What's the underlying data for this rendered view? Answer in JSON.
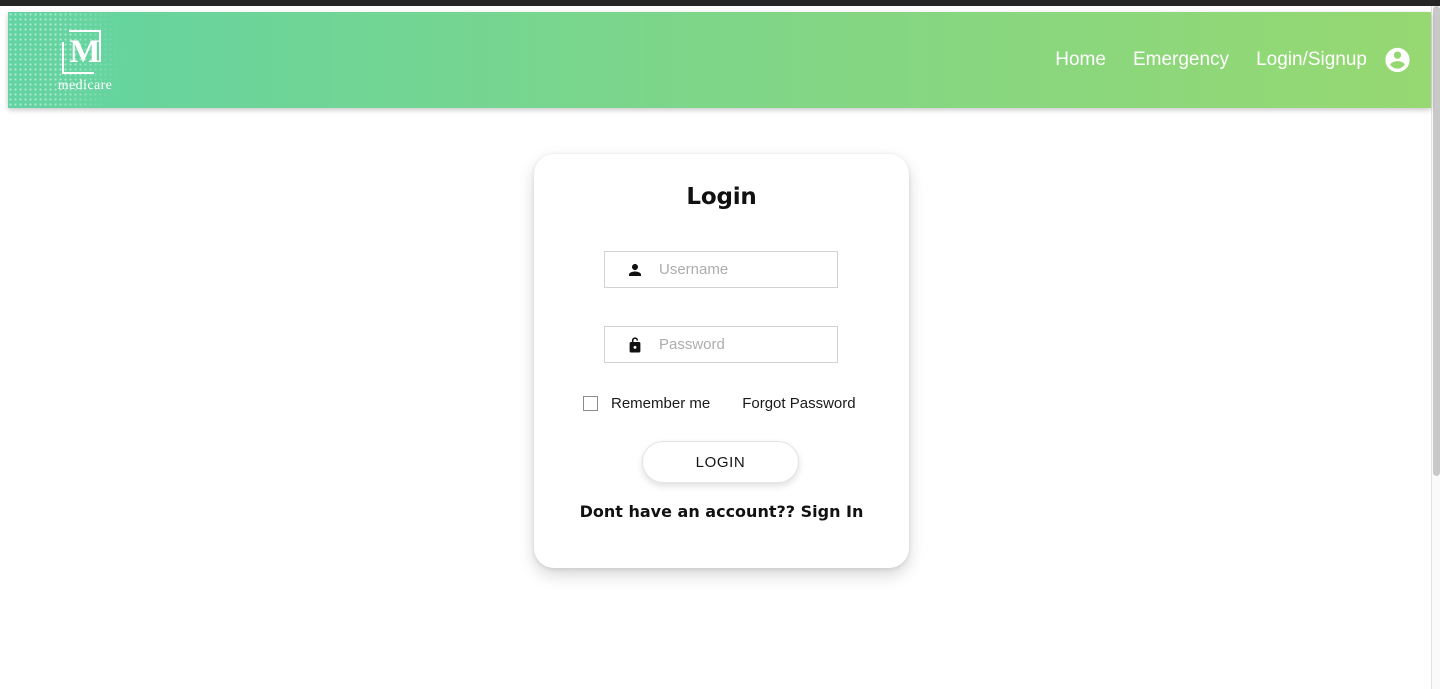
{
  "browser": {
    "chrome_bar_color": "#262626",
    "scrollbar": {
      "name": "page-scrollbar",
      "thumb_color": "#c9c9c9"
    }
  },
  "header": {
    "gradient_from": "#62d3a2",
    "gradient_to": "#96d872",
    "brand": {
      "letter": "M",
      "word": "medicare"
    },
    "nav": [
      {
        "label": "Home",
        "name": "nav-link-home"
      },
      {
        "label": "Emergency",
        "name": "nav-link-emergency"
      },
      {
        "label": "Login/Signup",
        "name": "nav-link-login-signup"
      }
    ],
    "account_icon": "account-circle-icon"
  },
  "login_card": {
    "title": "Login",
    "username": {
      "icon": "person-icon",
      "placeholder": "Username",
      "value": ""
    },
    "password": {
      "icon": "lock-open-icon",
      "placeholder": "Password",
      "value": ""
    },
    "remember_me": {
      "label": "Remember me",
      "checked": false
    },
    "forgot_password": "Forgot Password",
    "submit_label": "LOGIN",
    "signup_prompt": "Dont have an account?? Sign In"
  }
}
